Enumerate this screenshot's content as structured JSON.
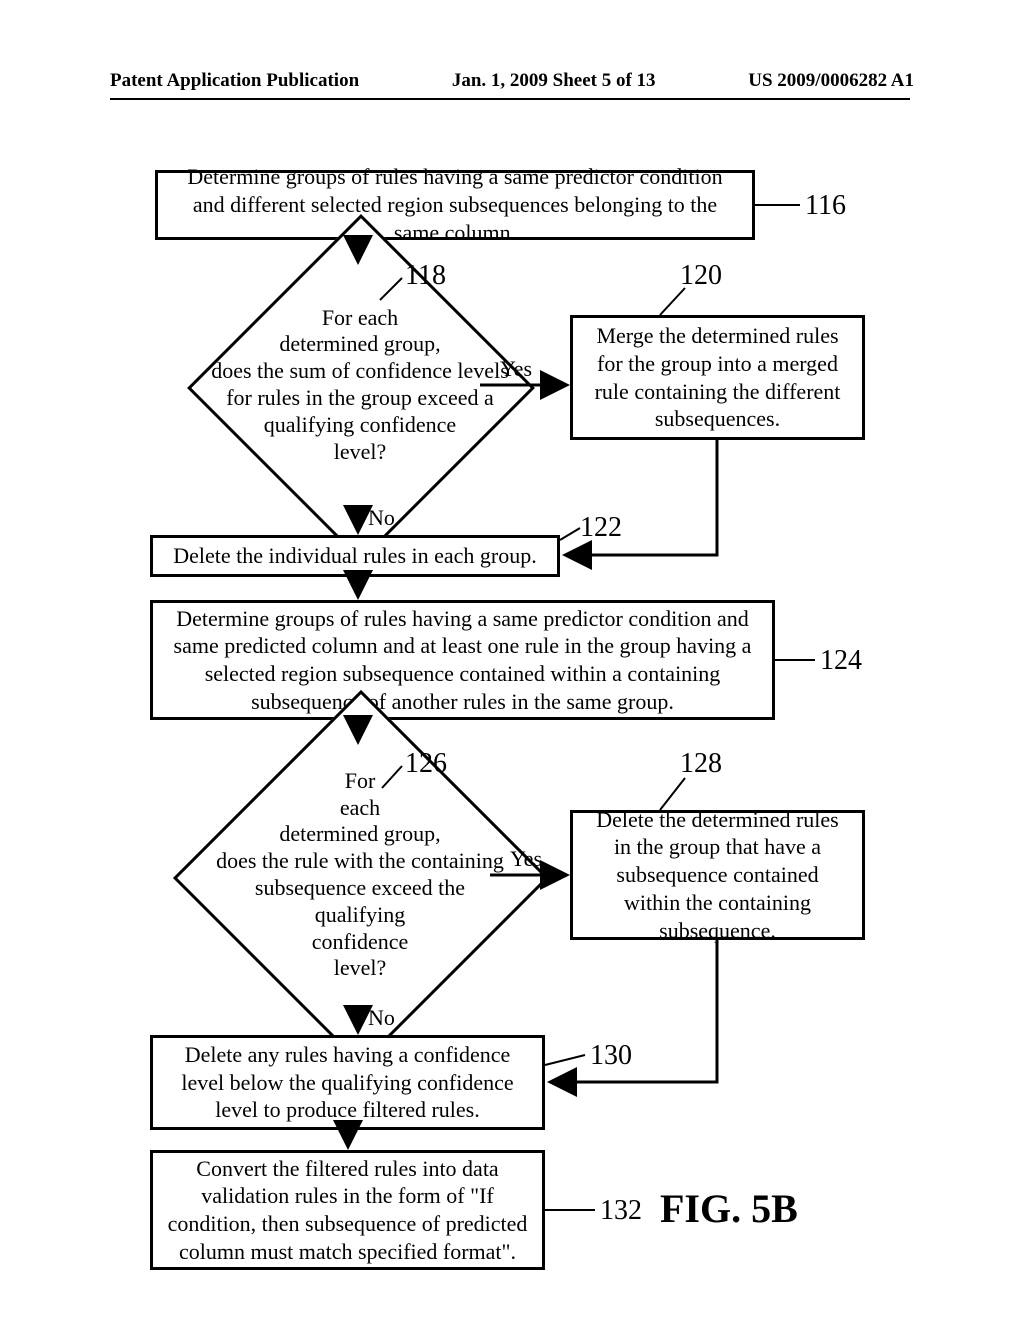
{
  "header": {
    "left": "Patent Application Publication",
    "center": "Jan. 1, 2009  Sheet 5 of 13",
    "right": "US 2009/0006282 A1"
  },
  "figure_label": "FIG. 5B",
  "refs": {
    "r116": "116",
    "r118": "118",
    "r120": "120",
    "r122": "122",
    "r124": "124",
    "r126": "126",
    "r128": "128",
    "r130": "130",
    "r132": "132"
  },
  "labels": {
    "yes": "Yes",
    "no": "No"
  },
  "boxes": {
    "b116": "Determine groups of rules having a same predictor condition and different selected region subsequences belonging to the same column.",
    "d118": "For each\ndetermined group,\ndoes the sum of confidence levels\nfor rules in the group exceed a\nqualifying confidence\nlevel?",
    "b120": "Merge the determined rules for the group into a merged rule containing the different subsequences.",
    "b122": "Delete the individual rules in each group.",
    "b124": "Determine groups of rules having a same predictor condition and same predicted column and at least one rule in the group having a selected region subsequence contained within a containing subsequence of another rules in the same group.",
    "d126": "For\neach\ndetermined group,\ndoes the rule with the containing\nsubsequence exceed the\nqualifying\nconfidence\nlevel?",
    "b128": "Delete the determined rules in the group that have a subsequence contained within the containing subsequence.",
    "b130": "Delete any rules having a confidence level below the qualifying confidence level to produce filtered rules.",
    "b132": "Convert the filtered rules into data validation rules in the form of \"If condition, then subsequence of predicted column must match specified format\"."
  }
}
